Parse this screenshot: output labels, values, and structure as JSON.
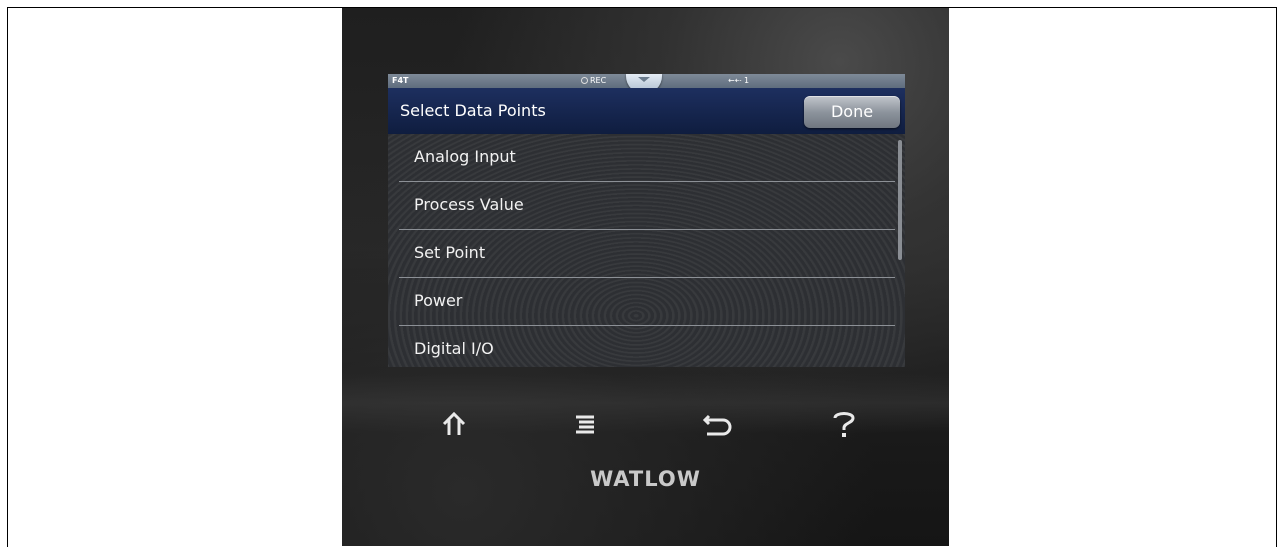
{
  "statusbar": {
    "model": "F4T",
    "rec_label": "REC",
    "usb_label": "←⇠ 1",
    "pulldown_icon": "chevron-down-icon"
  },
  "header": {
    "title": "Select Data Points",
    "done_label": "Done"
  },
  "list": {
    "items": [
      {
        "label": "Analog Input"
      },
      {
        "label": "Process Value"
      },
      {
        "label": "Set Point"
      },
      {
        "label": "Power"
      },
      {
        "label": "Digital I/O"
      }
    ]
  },
  "device": {
    "home_icon": "⌂",
    "menu_icon": "≣",
    "back_icon": "⮌",
    "help_icon": "?",
    "brand": "WATLOW"
  },
  "colors": {
    "title_bar": "#14254d",
    "status_bar": "#6f7c8b",
    "list_bg": "#2d2f33"
  }
}
